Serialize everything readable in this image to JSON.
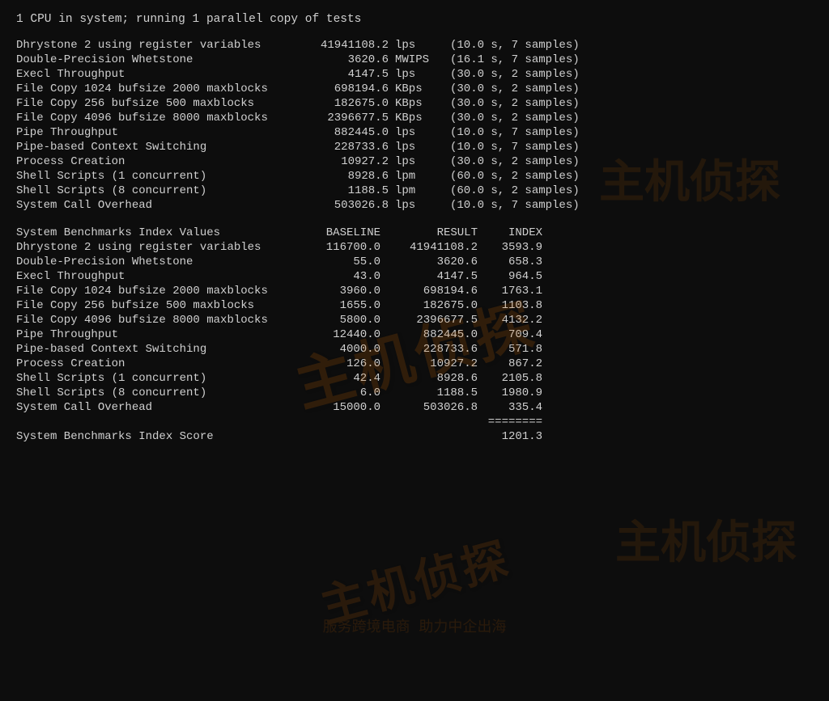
{
  "header": {
    "line1": "1 CPU in system; running 1 parallel copy of tests"
  },
  "benchmarks": [
    {
      "name": "Dhrystone 2 using register variables",
      "value": "41941108.2",
      "unit": "lps",
      "samples": "(10.0 s, 7 samples)"
    },
    {
      "name": "Double-Precision Whetstone",
      "value": "3620.6",
      "unit": "MWIPS",
      "samples": "(16.1 s, 7 samples)"
    },
    {
      "name": "Execl Throughput",
      "value": "4147.5",
      "unit": "lps",
      "samples": "(30.0 s, 2 samples)"
    },
    {
      "name": "File Copy 1024 bufsize 2000 maxblocks",
      "value": "698194.6",
      "unit": "KBps",
      "samples": "(30.0 s, 2 samples)"
    },
    {
      "name": "File Copy 256 bufsize 500 maxblocks",
      "value": "182675.0",
      "unit": "KBps",
      "samples": "(30.0 s, 2 samples)"
    },
    {
      "name": "File Copy 4096 bufsize 8000 maxblocks",
      "value": "2396677.5",
      "unit": "KBps",
      "samples": "(30.0 s, 2 samples)"
    },
    {
      "name": "Pipe Throughput",
      "value": "882445.0",
      "unit": "lps",
      "samples": "(10.0 s, 7 samples)"
    },
    {
      "name": "Pipe-based Context Switching",
      "value": "228733.6",
      "unit": "lps",
      "samples": "(10.0 s, 7 samples)"
    },
    {
      "name": "Process Creation",
      "value": "10927.2",
      "unit": "lps",
      "samples": "(30.0 s, 2 samples)"
    },
    {
      "name": "Shell Scripts (1 concurrent)",
      "value": "8928.6",
      "unit": "lpm",
      "samples": "(60.0 s, 2 samples)"
    },
    {
      "name": "Shell Scripts (8 concurrent)",
      "value": "1188.5",
      "unit": "lpm",
      "samples": "(60.0 s, 2 samples)"
    },
    {
      "name": "System Call Overhead",
      "value": "503026.8",
      "unit": "lps",
      "samples": "(10.0 s, 7 samples)"
    }
  ],
  "index_header": {
    "col1": "System Benchmarks Index Values",
    "col2": "BASELINE",
    "col3": "RESULT",
    "col4": "INDEX"
  },
  "index_rows": [
    {
      "name": "Dhrystone 2 using register variables",
      "baseline": "116700.0",
      "result": "41941108.2",
      "index": "3593.9"
    },
    {
      "name": "Double-Precision Whetstone",
      "baseline": "55.0",
      "result": "3620.6",
      "index": "658.3"
    },
    {
      "name": "Execl Throughput",
      "baseline": "43.0",
      "result": "4147.5",
      "index": "964.5"
    },
    {
      "name": "File Copy 1024 bufsize 2000 maxblocks",
      "baseline": "3960.0",
      "result": "698194.6",
      "index": "1763.1"
    },
    {
      "name": "File Copy 256 bufsize 500 maxblocks",
      "baseline": "1655.0",
      "result": "182675.0",
      "index": "1103.8"
    },
    {
      "name": "File Copy 4096 bufsize 8000 maxblocks",
      "baseline": "5800.0",
      "result": "2396677.5",
      "index": "4132.2"
    },
    {
      "name": "Pipe Throughput",
      "baseline": "12440.0",
      "result": "882445.0",
      "index": "709.4"
    },
    {
      "name": "Pipe-based Context Switching",
      "baseline": "4000.0",
      "result": "228733.6",
      "index": "571.8"
    },
    {
      "name": "Process Creation",
      "baseline": "126.0",
      "result": "10927.2",
      "index": "867.2"
    },
    {
      "name": "Shell Scripts (1 concurrent)",
      "baseline": "42.4",
      "result": "8928.6",
      "index": "2105.8"
    },
    {
      "name": "Shell Scripts (8 concurrent)",
      "baseline": "6.0",
      "result": "1188.5",
      "index": "1980.9"
    },
    {
      "name": "System Call Overhead",
      "baseline": "15000.0",
      "result": "503026.8",
      "index": "335.4"
    }
  ],
  "separator": "========",
  "final": {
    "name": "System Benchmarks Index Score",
    "score": "1201.3"
  },
  "watermarks": {
    "main": "主机侦探",
    "sub": "服务跨境电商 助力中企出海"
  }
}
